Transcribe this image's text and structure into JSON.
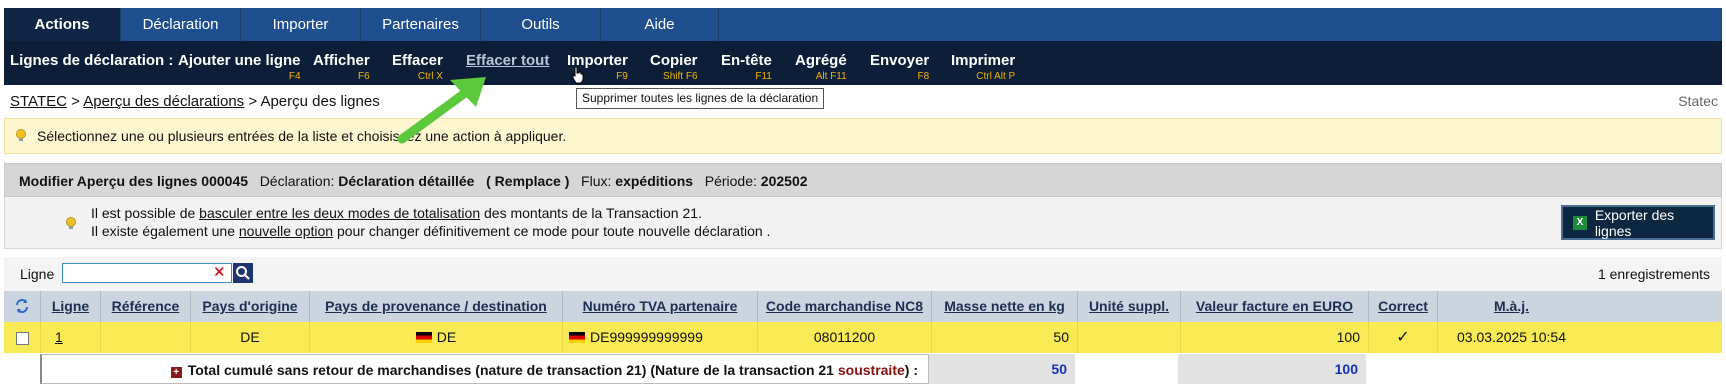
{
  "tabs": [
    "Actions",
    "Déclaration",
    "Importer",
    "Partenaires",
    "Outils",
    "Aide"
  ],
  "toolbar": {
    "title": "Lignes de déclaration :",
    "buttons": [
      {
        "label": "Ajouter une ligne",
        "key": "F4"
      },
      {
        "label": "Afficher",
        "key": "F6"
      },
      {
        "label": "Effacer",
        "key": "Ctrl X"
      },
      {
        "label": "Effacer tout",
        "key": ""
      },
      {
        "label": "Importer",
        "key": "F9"
      },
      {
        "label": "Copier",
        "key": "Shift F6"
      },
      {
        "label": "En-tête",
        "key": "F11"
      },
      {
        "label": "Agrégé",
        "key": "Alt F11"
      },
      {
        "label": "Envoyer",
        "key": "F8"
      },
      {
        "label": "Imprimer",
        "key": "Ctrl Alt P"
      }
    ]
  },
  "tooltip": "Supprimer toutes les lignes de la déclaration",
  "breadcrumb": {
    "root": "STATEC",
    "sep1": " > ",
    "parent": "Aperçu des déclarations",
    "sep2": " > ",
    "current": "Aperçu des lignes"
  },
  "app_name": "Statec",
  "info_message": "Sélectionnez une ou plusieurs entrées de la liste et choisissez une action à appliquer.",
  "panel": {
    "title": "Modifier Aperçu des lignes 000045",
    "declaration_label": "Déclaration:",
    "declaration_value": "Déclaration détaillée",
    "declaration_mode": "( Remplace )",
    "flux_label": "Flux:",
    "flux_value": "expéditions",
    "period_label": "Période:",
    "period_value": "202502",
    "note1_pre": "Il est possible de ",
    "note1_link": "basculer entre les deux modes de totalisation",
    "note1_post": " des montants de la Transaction 21.",
    "note2_pre": "Il existe également une ",
    "note2_link": "nouvelle option",
    "note2_post": " pour changer définitivement ce mode pour toute nouvelle déclaration .",
    "export_label": "Exporter des lignes"
  },
  "filter": {
    "label": "Ligne",
    "value": "",
    "count": "1 enregistrements"
  },
  "table": {
    "headers": [
      "Ligne",
      "Référence",
      "Pays d'origine",
      "Pays de provenance / destination",
      "Numéro TVA partenaire",
      "Code marchandise NC8",
      "Masse nette en kg",
      "Unité suppl.",
      "Valeur facture en EURO",
      "Correct",
      "M.à.j."
    ],
    "row": {
      "ligne": "1",
      "reference": "",
      "pays_origine": "DE",
      "pays_provenance": "DE",
      "tva": "DE999999999999",
      "code_nc8": "08011200",
      "masse": "50",
      "unite": "",
      "valeur": "100",
      "correct": "✓",
      "maj": "03.03.2025 10:54"
    },
    "total": {
      "label_pre": "Total cumulé sans retour de marchandises (nature de transaction 21) (Nature de la transaction 21 ",
      "label_em": "soustraite",
      "label_post": ") :",
      "masse": "50",
      "valeur": "100"
    }
  },
  "colors": {
    "tab_bar": "#1f4f8e",
    "toolbar": "#0d1f38",
    "shortcut": "#f2b200",
    "highlight_row": "#f7ea55",
    "arrow": "#5cc83c"
  }
}
